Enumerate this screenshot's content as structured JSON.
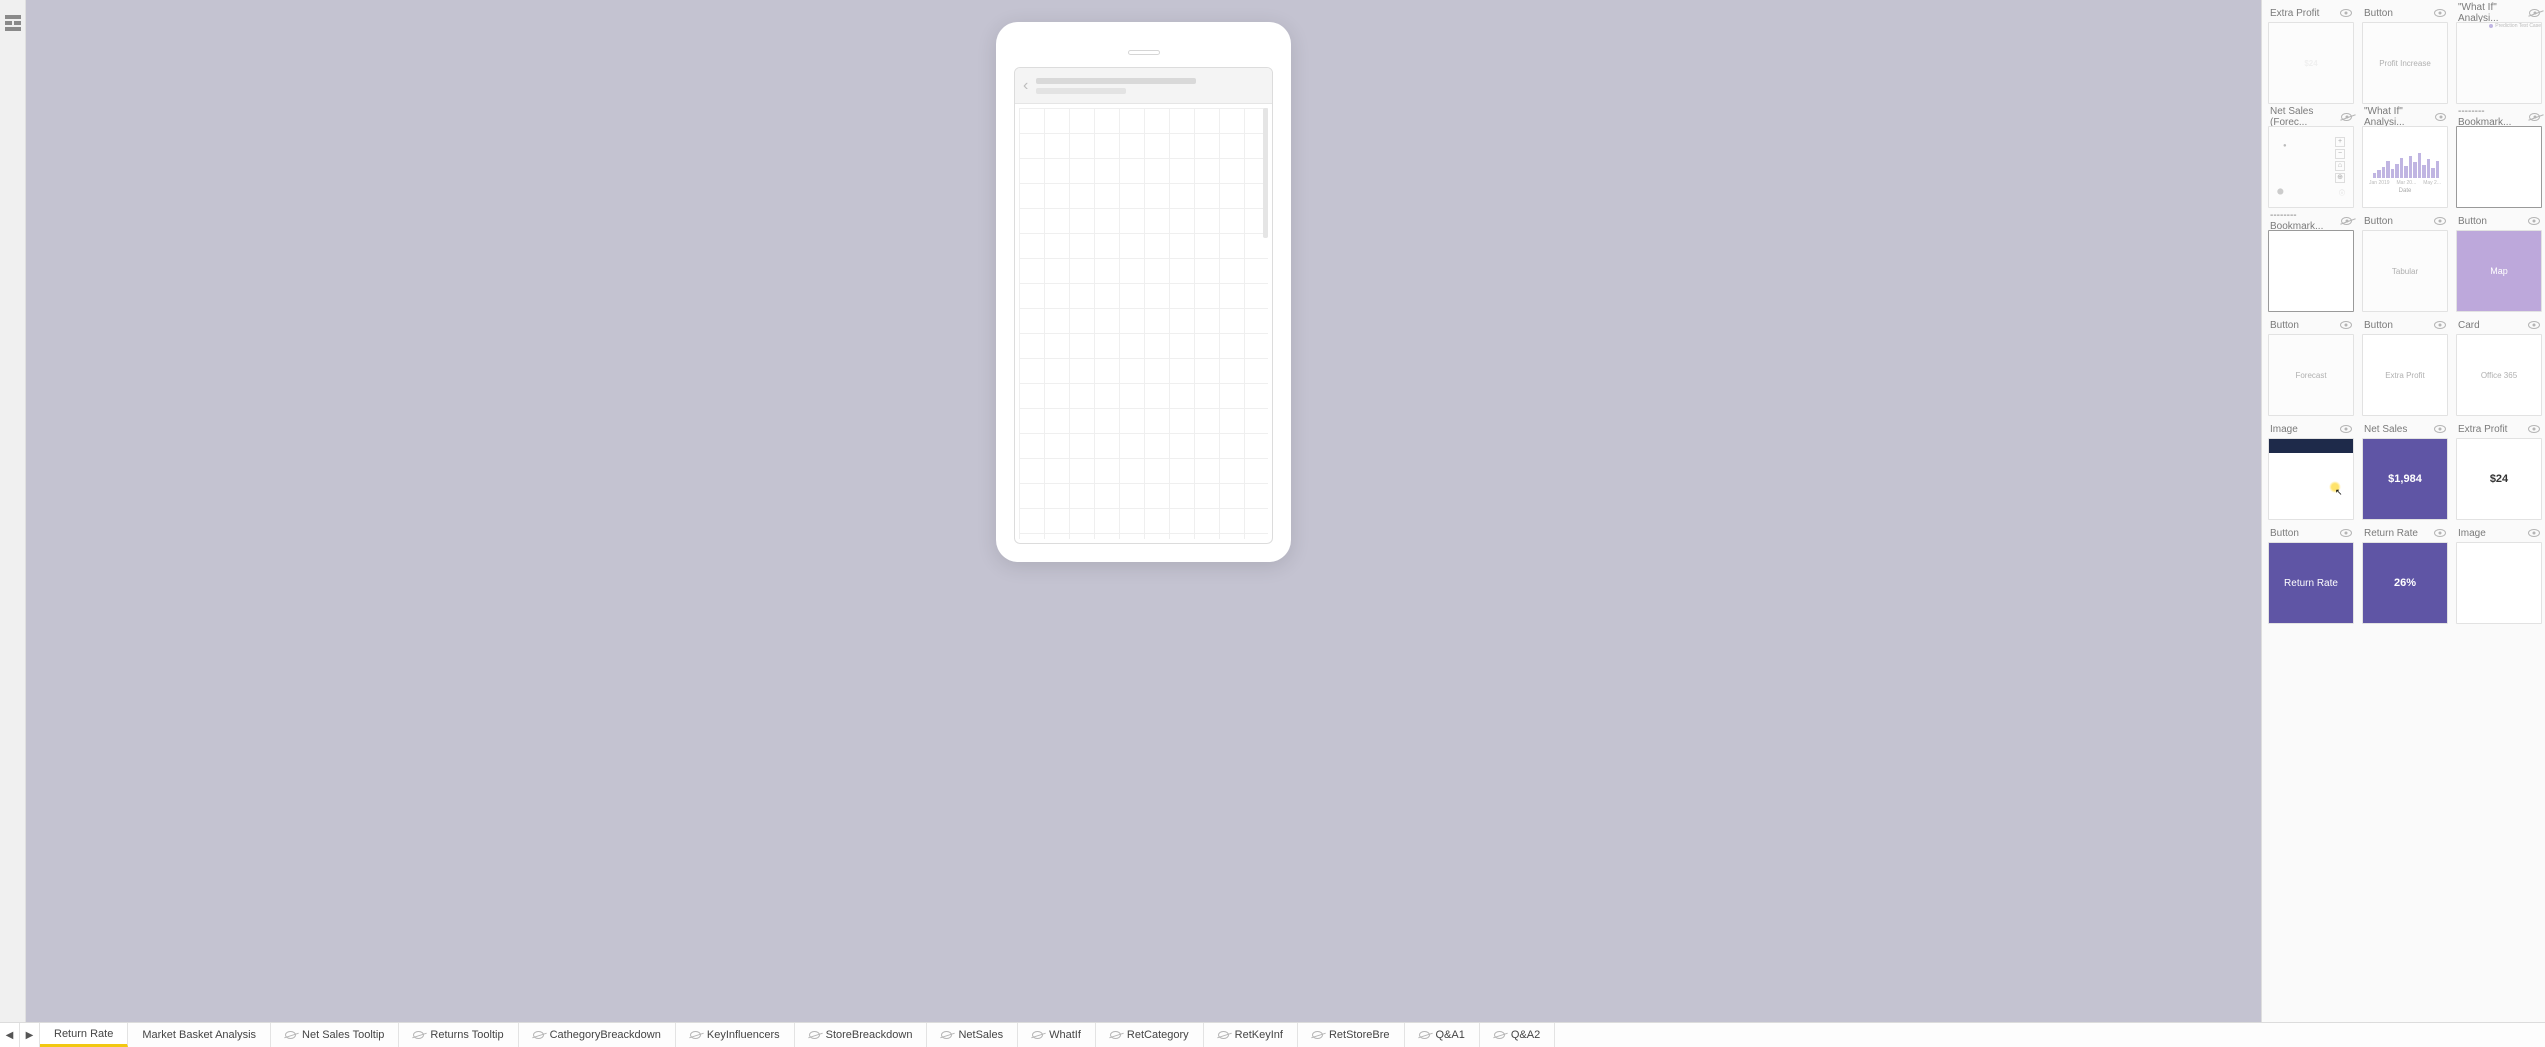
{
  "left_rail": {
    "icon": "mobile-layout-icon"
  },
  "tiles": {
    "rows": [
      [
        {
          "title": "Extra Profit",
          "variant": "faded",
          "content_type": "text-white",
          "content": "$24",
          "hidden": false
        },
        {
          "title": "Button",
          "variant": "faded",
          "content_type": "text",
          "content": "Profit Increase",
          "hidden": false
        },
        {
          "title": "\"What If\" Analysi...",
          "variant": "faded",
          "content_type": "legend",
          "content": "Prediction Test Case",
          "hidden": true
        }
      ],
      [
        {
          "title": "Net Sales (Forec...",
          "variant": "faded",
          "content_type": "map",
          "hidden": true
        },
        {
          "title": "\"What If\" Analysi...",
          "variant": "",
          "content_type": "chart",
          "hidden": false
        },
        {
          "title": "--------Bookmark...",
          "variant": "sel",
          "content_type": "empty",
          "hidden": true
        }
      ],
      [
        {
          "title": "--------Bookmark...",
          "variant": "sel",
          "content_type": "empty",
          "hidden": true
        },
        {
          "title": "Button",
          "variant": "faded",
          "content_type": "text",
          "content": "Tabular",
          "hidden": false
        },
        {
          "title": "Button",
          "variant": "purp",
          "content_type": "text-plain",
          "content": "Map",
          "hidden": false
        }
      ],
      [
        {
          "title": "Button",
          "variant": "faded",
          "content_type": "text",
          "content": "Forecast",
          "hidden": false
        },
        {
          "title": "Button",
          "variant": "",
          "content_type": "text",
          "content": "Extra Profit",
          "hidden": false
        },
        {
          "title": "Card",
          "variant": "",
          "content_type": "text",
          "content": "Office 365",
          "hidden": false
        }
      ],
      [
        {
          "title": "Image",
          "variant": "",
          "content_type": "image-cursor",
          "hidden": false
        },
        {
          "title": "Net Sales",
          "variant": "purpdark",
          "content_type": "text-plain",
          "content": "$1,984",
          "hidden": false
        },
        {
          "title": "Extra Profit",
          "variant": "",
          "content_type": "text-center",
          "content": "$24",
          "hidden": false
        }
      ],
      [
        {
          "title": "Button",
          "variant": "purpdark2",
          "content_type": "text-plain",
          "content": "Return Rate",
          "hidden": false
        },
        {
          "title": "Return Rate",
          "variant": "purpdark",
          "content_type": "text-plain",
          "content": "26%",
          "hidden": false
        },
        {
          "title": "Image",
          "variant": "",
          "content_type": "empty",
          "hidden": false
        }
      ]
    ],
    "chart_detail": {
      "xlabel": "Date",
      "xticks": [
        "Jan 2019",
        "Mar 20...",
        "May 2..."
      ]
    }
  },
  "tabs": {
    "items": [
      {
        "label": "Return Rate",
        "active": true,
        "hidden_icon": false
      },
      {
        "label": "Market Basket Analysis",
        "active": false,
        "hidden_icon": false
      },
      {
        "label": "Net Sales Tooltip",
        "active": false,
        "hidden_icon": true
      },
      {
        "label": "Returns Tooltip",
        "active": false,
        "hidden_icon": true
      },
      {
        "label": "CathegoryBreackdown",
        "active": false,
        "hidden_icon": true
      },
      {
        "label": "KeyInfluencers",
        "active": false,
        "hidden_icon": true
      },
      {
        "label": "StoreBreackdown",
        "active": false,
        "hidden_icon": true
      },
      {
        "label": "NetSales",
        "active": false,
        "hidden_icon": true
      },
      {
        "label": "WhatIf",
        "active": false,
        "hidden_icon": true
      },
      {
        "label": "RetCategory",
        "active": false,
        "hidden_icon": true
      },
      {
        "label": "RetKeyInf",
        "active": false,
        "hidden_icon": true
      },
      {
        "label": "RetStoreBre",
        "active": false,
        "hidden_icon": true
      },
      {
        "label": "Q&A1",
        "active": false,
        "hidden_icon": true
      },
      {
        "label": "Q&A2",
        "active": false,
        "hidden_icon": true
      }
    ]
  }
}
